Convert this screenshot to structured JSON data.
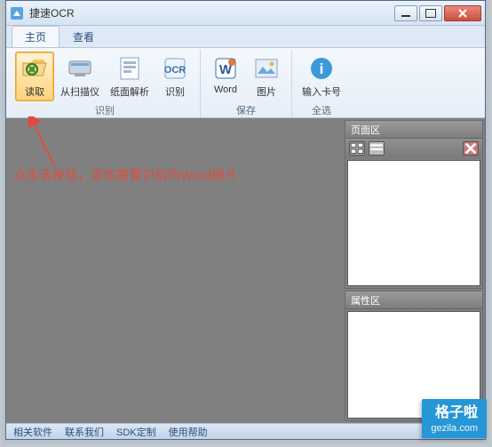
{
  "window": {
    "title": "捷速OCR"
  },
  "tabs": {
    "main": "主页",
    "view": "查看"
  },
  "ribbon": {
    "read": "读取",
    "scanner": "从扫描仪",
    "pageparse": "纸面解析",
    "recognize": "识别",
    "word": "Word",
    "image": "图片",
    "entercard": "输入卡号",
    "group_identify": "识别",
    "group_save": "保存",
    "group_all": "全选"
  },
  "annotation": "点击该按钮，添加需要识别的Word图片",
  "panels": {
    "pages": "页面区",
    "properties": "属性区"
  },
  "status": {
    "related": "相关软件",
    "contact": "联系我们",
    "sdk": "SDK定制",
    "help": "使用帮助"
  },
  "watermark": {
    "top": "格子啦",
    "bottom": "gezila.com"
  }
}
